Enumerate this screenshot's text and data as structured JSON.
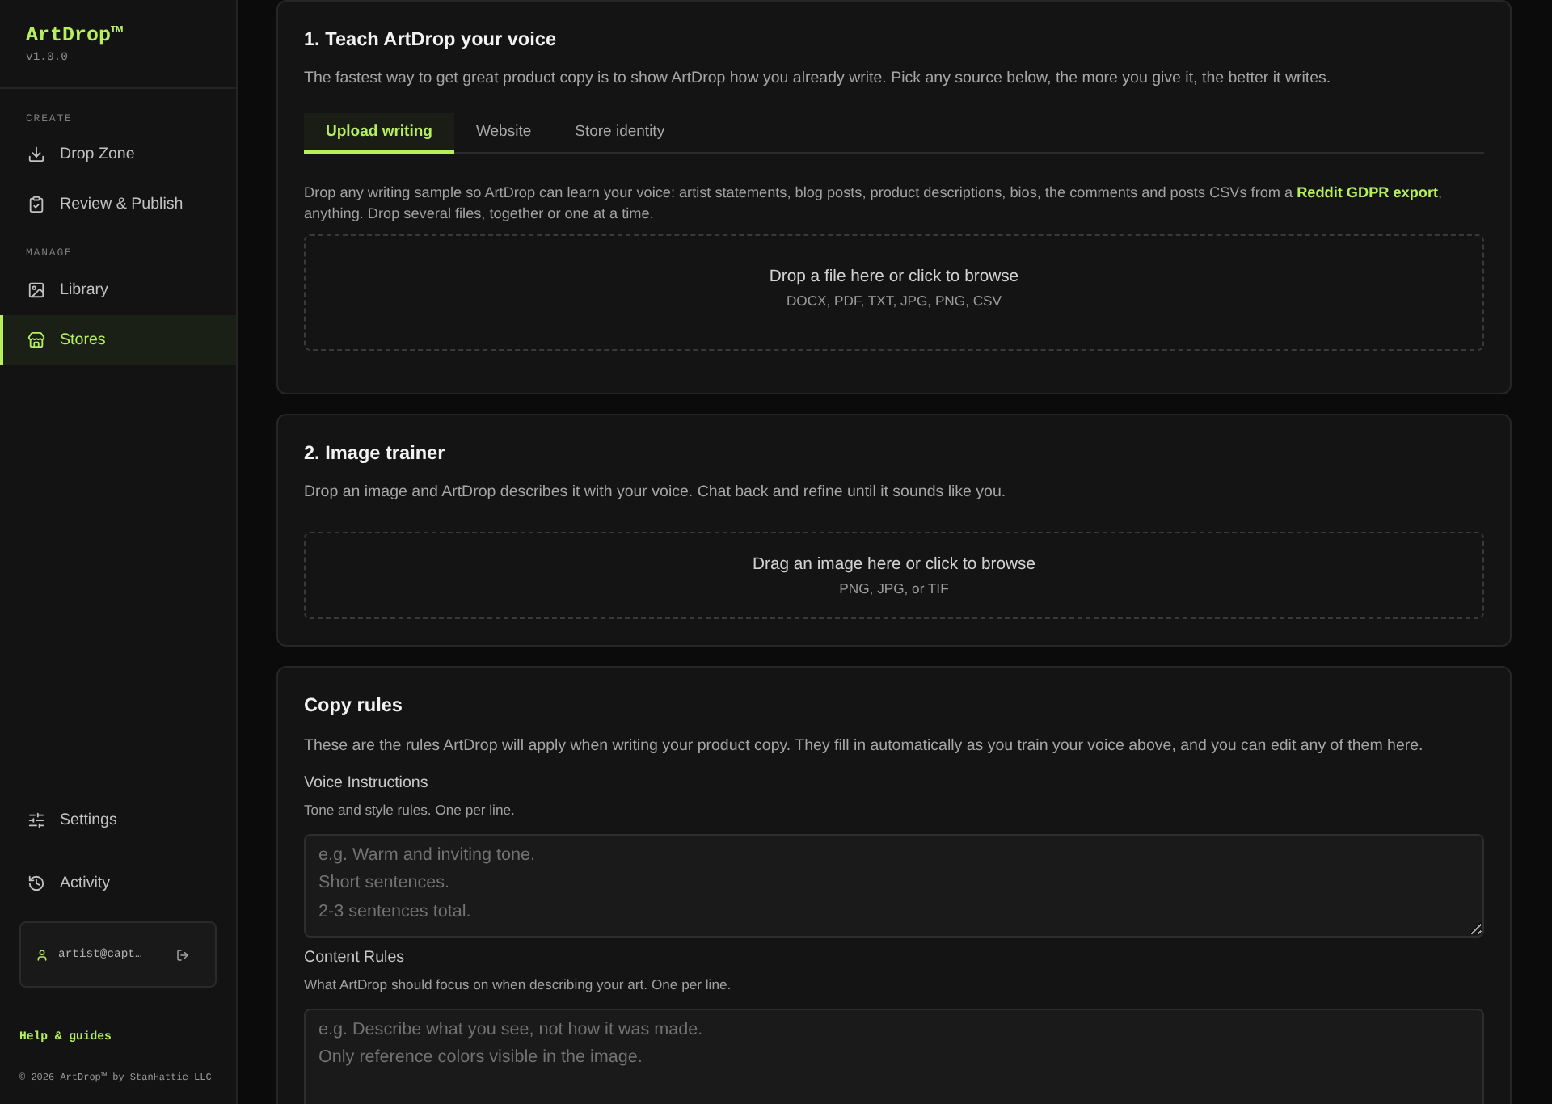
{
  "sidebar": {
    "brand": "ArtDrop™",
    "version": "v1.0.0",
    "sections": [
      {
        "heading": "CREATE",
        "items": [
          {
            "label": "Drop Zone",
            "selected": false
          },
          {
            "label": "Review & Publish",
            "selected": false
          }
        ]
      },
      {
        "heading": "MANAGE",
        "items": [
          {
            "label": "Library",
            "selected": false
          },
          {
            "label": "Stores",
            "selected": true
          }
        ]
      }
    ],
    "footer_items": [
      {
        "label": "Settings",
        "selected": false
      },
      {
        "label": "Activity",
        "selected": false
      }
    ],
    "user": {
      "email": "artist@capt…"
    },
    "help_link": "Help & guides",
    "copyright": "© 2026 ArtDrop™ by StanHattie LLC"
  },
  "voice_training": {
    "title": "1. Teach ArtDrop your voice",
    "description": "The fastest way to get great product copy is to show ArtDrop how you already write. Pick any source below, the more you give it, the better it writes.",
    "tabs": [
      {
        "label": "Upload writing",
        "selected": true
      },
      {
        "label": "Website",
        "selected": false
      },
      {
        "label": "Store identity",
        "selected": false
      }
    ],
    "instructions": {
      "before": "Drop any writing sample so ArtDrop can learn your voice: artist statements, blog posts, product descriptions, bios, the comments and posts CSVs from a ",
      "link": "Reddit GDPR export",
      "after": ", anything. Drop several files, together or one at a time."
    },
    "dropzone": {
      "title": "Drop a file here or click to browse",
      "formats": "DOCX, PDF, TXT, JPG, PNG, CSV"
    }
  },
  "image_trainer": {
    "title": "2. Image trainer",
    "description": "Drop an image and ArtDrop describes it with your voice. Chat back and refine until it sounds like you.",
    "dropzone": {
      "title": "Drag an image here or click to browse",
      "formats": "PNG, JPG, or TIF"
    }
  },
  "copy_rules": {
    "title": "Copy rules",
    "description": "These are the rules ArtDrop will apply when writing your product copy. They fill in automatically as you train your voice above, and you can edit any of them here.",
    "fields": [
      {
        "label": "Voice Instructions",
        "hint": "Tone and style rules. One per line.",
        "placeholder": "e.g. Warm and inviting tone.\nShort sentences.\n2-3 sentences total."
      },
      {
        "label": "Content Rules",
        "hint": "What ArtDrop should focus on when describing your art. One per line.",
        "placeholder": "e.g. Describe what you see, not how it was made.\nOnly reference colors visible in the image."
      }
    ]
  }
}
